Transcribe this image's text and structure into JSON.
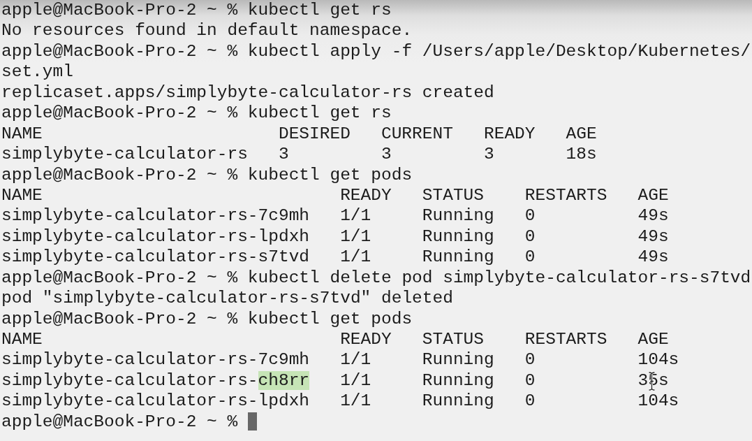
{
  "terminal": {
    "lines": [
      {
        "kind": "command",
        "prompt": "apple@MacBook-Pro-2 ~ %",
        "command": "kubectl get rs"
      },
      {
        "kind": "output",
        "text": "No resources found in default namespace."
      },
      {
        "kind": "command",
        "prompt": "apple@MacBook-Pro-2 ~ %",
        "command": "kubectl apply -f /Users/apple/Desktop/Kubernetes/"
      },
      {
        "kind": "output",
        "text": "set.yml"
      },
      {
        "kind": "output",
        "text": "replicaset.apps/simplybyte-calculator-rs created"
      },
      {
        "kind": "command",
        "prompt": "apple@MacBook-Pro-2 ~ %",
        "command": "kubectl get rs"
      },
      {
        "kind": "table",
        "columns": [
          "NAME",
          "DESIRED",
          "CURRENT",
          "READY",
          "AGE"
        ],
        "rows": [
          {
            "cells": [
              "simplybyte-calculator-rs",
              "3",
              "3",
              "3",
              "18s"
            ]
          }
        ]
      },
      {
        "kind": "command",
        "prompt": "apple@MacBook-Pro-2 ~ %",
        "command": "kubectl get pods"
      },
      {
        "kind": "table",
        "columns": [
          "NAME",
          "READY",
          "STATUS",
          "RESTARTS",
          "AGE"
        ],
        "rows": [
          {
            "cells": [
              "simplybyte-calculator-rs-7c9mh",
              "1/1",
              "Running",
              "0",
              "49s"
            ]
          },
          {
            "cells": [
              "simplybyte-calculator-rs-lpdxh",
              "1/1",
              "Running",
              "0",
              "49s"
            ]
          },
          {
            "cells": [
              "simplybyte-calculator-rs-s7tvd",
              "1/1",
              "Running",
              "0",
              "49s"
            ]
          }
        ]
      },
      {
        "kind": "command",
        "prompt": "apple@MacBook-Pro-2 ~ %",
        "command": "kubectl delete pod simplybyte-calculator-rs-s7tvd"
      },
      {
        "kind": "output",
        "text": "pod \"simplybyte-calculator-rs-s7tvd\" deleted"
      },
      {
        "kind": "command",
        "prompt": "apple@MacBook-Pro-2 ~ %",
        "command": "kubectl get pods"
      },
      {
        "kind": "table",
        "columns": [
          "NAME",
          "READY",
          "STATUS",
          "RESTARTS",
          "AGE"
        ],
        "rows": [
          {
            "cells": [
              "simplybyte-calculator-rs-7c9mh",
              "1/1",
              "Running",
              "0",
              "104s"
            ]
          },
          {
            "cells": [
              {
                "segments": [
                  {
                    "text": "simplybyte-calculator-rs-",
                    "highlighted": false
                  },
                  {
                    "text": "ch8rr",
                    "highlighted": true
                  }
                ]
              },
              "1/1",
              "Running",
              "0",
              {
                "text": "35s",
                "mouse_pointer": true
              }
            ]
          },
          {
            "cells": [
              "simplybyte-calculator-rs-lpdxh",
              "1/1",
              "Running",
              "0",
              "104s"
            ]
          }
        ]
      },
      {
        "kind": "input",
        "prompt": "apple@MacBook-Pro-2 ~ %"
      }
    ]
  }
}
